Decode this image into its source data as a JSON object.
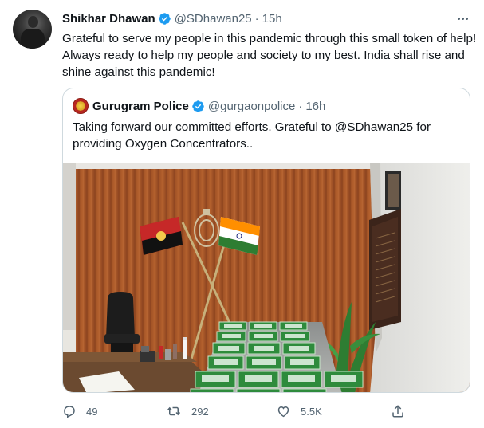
{
  "tweet": {
    "author_name": "Shikhar Dhawan",
    "author_handle": "@SDhawan25",
    "separator": "·",
    "time": "15h",
    "text": "Grateful to serve my people in this pandemic through this small token of help! Always ready to help my people and society to my best. India shall rise and shine against this pandemic!"
  },
  "quoted_tweet": {
    "author_name": "Gurugram Police",
    "author_handle": "@gurgaonpolice",
    "separator": "·",
    "time": "16h",
    "text": "Taking forward our committed efforts. Grateful to @SDhawan25 for providing Oxygen Concentrators.."
  },
  "actions": {
    "reply_count": "49",
    "retweet_count": "292",
    "like_count": "5.5K"
  },
  "colors": {
    "verified_blue": "#1d9bf0",
    "secondary_text": "#536471",
    "border": "#cfd9de"
  },
  "icons": [
    "more-icon",
    "verified-badge-icon",
    "reply-icon",
    "retweet-icon",
    "like-icon",
    "share-icon"
  ]
}
